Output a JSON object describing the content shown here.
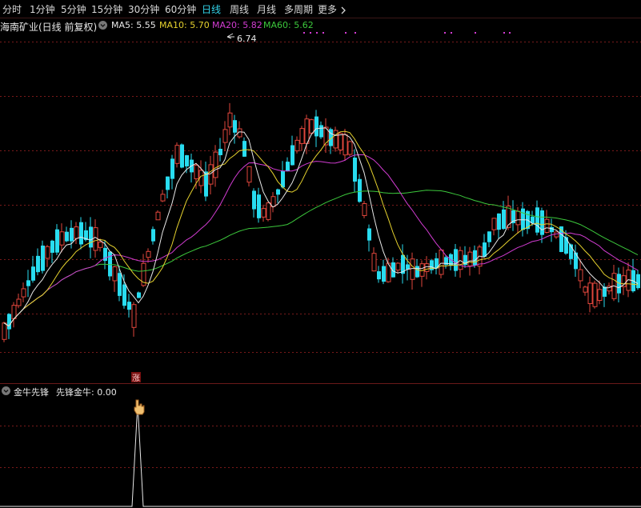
{
  "toolbar": {
    "periods": [
      "分时",
      "1分钟",
      "5分钟",
      "15分钟",
      "30分钟",
      "60分钟",
      "日线",
      "周线",
      "月线",
      "多周期"
    ],
    "active": "日线",
    "more_label": "更多",
    "more_icon": "chevron-right-icon"
  },
  "main_chart": {
    "title": "海南矿业(日线 前复权)",
    "settings_icon": "chevron-down-icon",
    "ma_labels": [
      {
        "text": "MA5: 5.55",
        "color": "#e8e8e8"
      },
      {
        "text": "MA10: 5.70",
        "color": "#e6d22e"
      },
      {
        "text": "MA20: 5.82",
        "color": "#d23cd2"
      },
      {
        "text": "MA60: 5.62",
        "color": "#3cc83c"
      }
    ],
    "high_annotation": "6.74",
    "limit_up_marker": "涨",
    "colors": {
      "up": "#e0463c",
      "down": "#28dcf0",
      "ma5": "#e8e8e8",
      "ma10": "#e6d22e",
      "ma20": "#d23cd2",
      "ma60": "#3cc83c",
      "grid": "#7a1a1a"
    }
  },
  "sub_chart": {
    "indicator_name": "金牛先锋",
    "value_label": "先锋金牛: 0.00",
    "settings_icon": "chevron-down-icon",
    "cursor_icon": "pointing-hand-icon"
  }
}
